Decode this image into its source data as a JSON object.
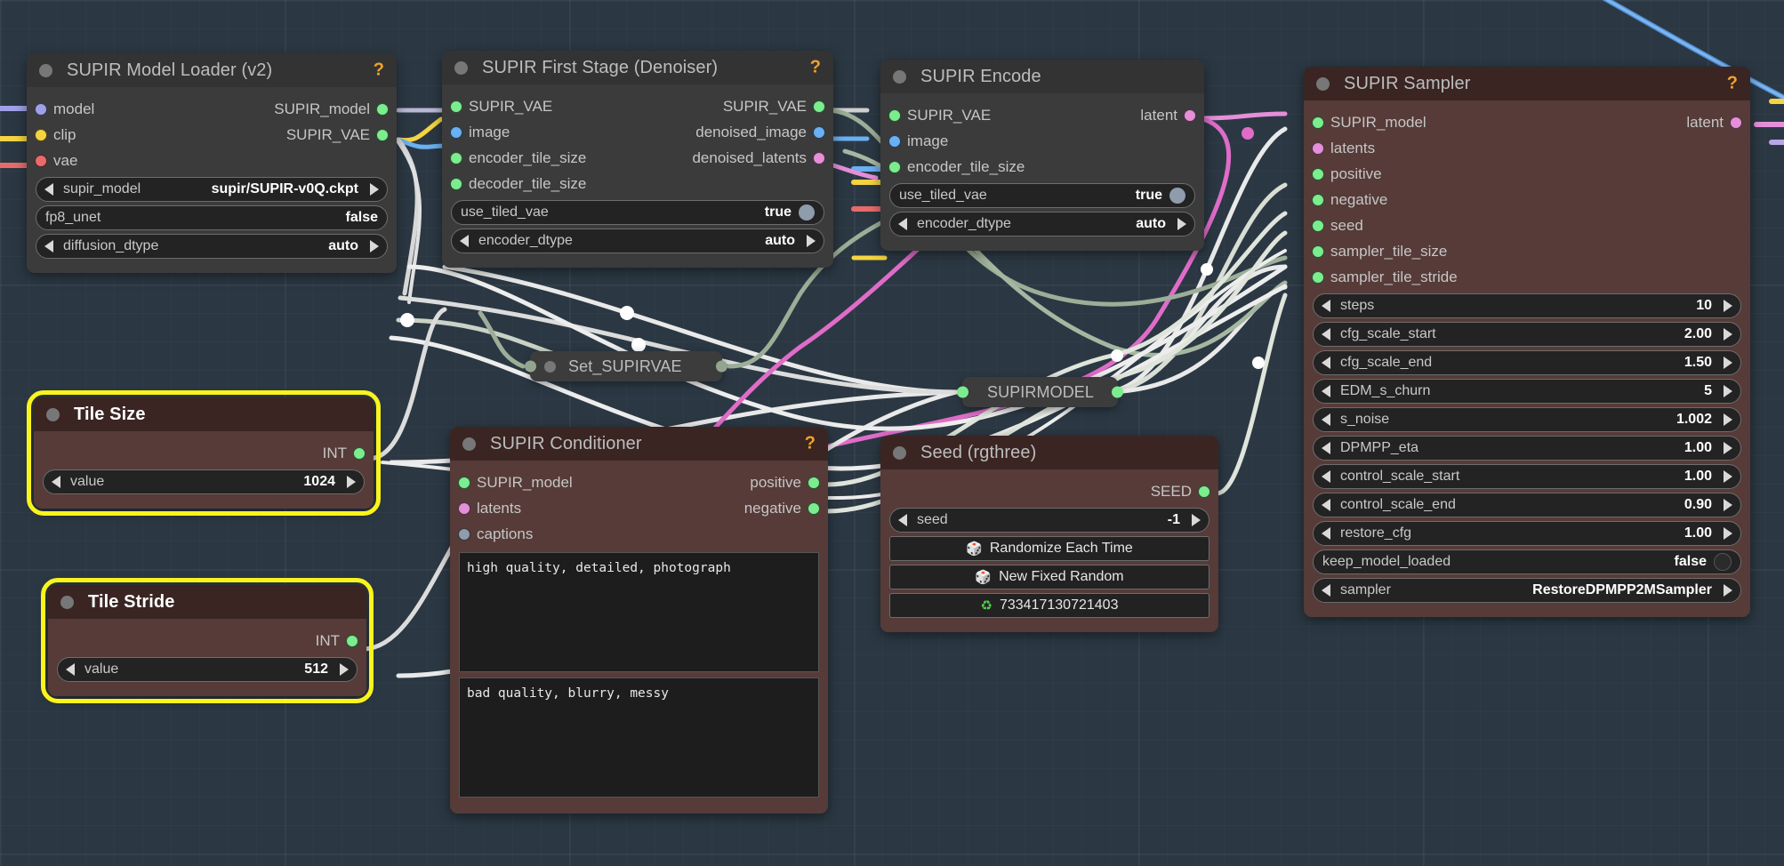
{
  "canvas": {
    "background_color": "#2b3843",
    "grid": true
  },
  "nodes": [
    {
      "id": "supir-model-loader",
      "title": "SUPIR Model Loader (v2)",
      "skin": "dark",
      "help": "?",
      "inputs": [
        {
          "label": "model",
          "color": "#a0a0e8"
        },
        {
          "label": "clip",
          "color": "#f5d442"
        },
        {
          "label": "vae",
          "color": "#e86b6b"
        }
      ],
      "outputs": [
        {
          "label": "SUPIR_model",
          "color": "#7bed8f"
        },
        {
          "label": "SUPIR_VAE",
          "color": "#7bed8f"
        }
      ],
      "widgets": [
        {
          "kind": "combo",
          "name": "supir_model",
          "value": "supir/SUPIR-v0Q.ckpt"
        },
        {
          "kind": "toggle",
          "name": "fp8_unet",
          "value": "false",
          "on": false
        },
        {
          "kind": "combo",
          "name": "diffusion_dtype",
          "value": "auto"
        }
      ]
    },
    {
      "id": "supir-first-stage",
      "title": "SUPIR First Stage (Denoiser)",
      "skin": "dark",
      "help": "?",
      "inputs": [
        {
          "label": "SUPIR_VAE",
          "color": "#7bed8f"
        },
        {
          "label": "image",
          "color": "#6ab0f3"
        },
        {
          "label": "encoder_tile_size",
          "color": "#7bed8f"
        },
        {
          "label": "decoder_tile_size",
          "color": "#7bed8f"
        }
      ],
      "outputs": [
        {
          "label": "SUPIR_VAE",
          "color": "#7bed8f"
        },
        {
          "label": "denoised_image",
          "color": "#6ab0f3"
        },
        {
          "label": "denoised_latents",
          "color": "#e58fd8"
        }
      ],
      "widgets": [
        {
          "kind": "toggle",
          "name": "use_tiled_vae",
          "value": "true",
          "on": true
        },
        {
          "kind": "combo",
          "name": "encoder_dtype",
          "value": "auto"
        }
      ]
    },
    {
      "id": "supir-encode",
      "title": "SUPIR Encode",
      "skin": "dark",
      "help": "",
      "inputs": [
        {
          "label": "SUPIR_VAE",
          "color": "#7bed8f"
        },
        {
          "label": "image",
          "color": "#6ab0f3"
        },
        {
          "label": "encoder_tile_size",
          "color": "#7bed8f"
        }
      ],
      "outputs": [
        {
          "label": "latent",
          "color": "#e58fd8"
        }
      ],
      "widgets": [
        {
          "kind": "toggle",
          "name": "use_tiled_vae",
          "value": "true",
          "on": true
        },
        {
          "kind": "combo",
          "name": "encoder_dtype",
          "value": "auto"
        }
      ]
    },
    {
      "id": "supir-sampler",
      "title": "SUPIR Sampler",
      "skin": "maroon",
      "help": "?",
      "inputs": [
        {
          "label": "SUPIR_model",
          "color": "#7bed8f"
        },
        {
          "label": "latents",
          "color": "#e58fd8"
        },
        {
          "label": "positive",
          "color": "#7bed8f"
        },
        {
          "label": "negative",
          "color": "#7bed8f"
        },
        {
          "label": "seed",
          "color": "#7bed8f"
        },
        {
          "label": "sampler_tile_size",
          "color": "#7bed8f"
        },
        {
          "label": "sampler_tile_stride",
          "color": "#7bed8f"
        }
      ],
      "outputs": [
        {
          "label": "latent",
          "color": "#e58fd8"
        }
      ],
      "widgets": [
        {
          "kind": "combo",
          "name": "steps",
          "value": "10"
        },
        {
          "kind": "combo",
          "name": "cfg_scale_start",
          "value": "2.00"
        },
        {
          "kind": "combo",
          "name": "cfg_scale_end",
          "value": "1.50"
        },
        {
          "kind": "combo",
          "name": "EDM_s_churn",
          "value": "5"
        },
        {
          "kind": "combo",
          "name": "s_noise",
          "value": "1.002"
        },
        {
          "kind": "combo",
          "name": "DPMPP_eta",
          "value": "1.00"
        },
        {
          "kind": "combo",
          "name": "control_scale_start",
          "value": "1.00"
        },
        {
          "kind": "combo",
          "name": "control_scale_end",
          "value": "0.90"
        },
        {
          "kind": "combo",
          "name": "restore_cfg",
          "value": "1.00"
        },
        {
          "kind": "toggle",
          "name": "keep_model_loaded",
          "value": "false",
          "on": false
        },
        {
          "kind": "combo",
          "name": "sampler",
          "value": "RestoreDPMPP2MSampler"
        }
      ]
    },
    {
      "id": "tile-size",
      "title": "Tile Size",
      "skin": "maroon",
      "selected": true,
      "help": "",
      "inputs": [],
      "outputs": [
        {
          "label": "INT",
          "color": "#7bed8f"
        }
      ],
      "widgets": [
        {
          "kind": "combo",
          "name": "value",
          "value": "1024"
        }
      ]
    },
    {
      "id": "tile-stride",
      "title": "Tile Stride",
      "skin": "maroon",
      "selected": true,
      "help": "",
      "inputs": [],
      "outputs": [
        {
          "label": "INT",
          "color": "#7bed8f"
        }
      ],
      "widgets": [
        {
          "kind": "combo",
          "name": "value",
          "value": "512"
        }
      ]
    },
    {
      "id": "supir-conditioner",
      "title": "SUPIR Conditioner",
      "skin": "maroon",
      "help": "?",
      "inputs": [
        {
          "label": "SUPIR_model",
          "color": "#7bed8f"
        },
        {
          "label": "latents",
          "color": "#e58fd8"
        },
        {
          "label": "captions",
          "color": "#8e9cab"
        }
      ],
      "outputs": [
        {
          "label": "positive",
          "color": "#7bed8f"
        },
        {
          "label": "negative",
          "color": "#7bed8f"
        }
      ],
      "widgets": [
        {
          "kind": "text",
          "name": "positive_prompt",
          "value": "high quality, detailed, photograph"
        },
        {
          "kind": "text",
          "name": "negative_prompt",
          "value": "bad quality, blurry, messy"
        }
      ]
    },
    {
      "id": "seed-rgthree",
      "title": "Seed (rgthree)",
      "skin": "maroon",
      "help": "",
      "inputs": [],
      "outputs": [
        {
          "label": "SEED",
          "color": "#7bed8f"
        }
      ],
      "widgets": [
        {
          "kind": "combo",
          "name": "seed",
          "value": "-1"
        },
        {
          "kind": "button",
          "name": "randomize_each_time",
          "icon": "dice-icon",
          "glyph": "🎲",
          "value": "Randomize Each Time"
        },
        {
          "kind": "button",
          "name": "new_fixed_random",
          "icon": "dice-icon",
          "glyph": "🎲",
          "value": "New Fixed Random"
        },
        {
          "kind": "button",
          "name": "last_seed",
          "icon": "recycle-icon",
          "glyph": "♻",
          "value": "733417130721403"
        }
      ]
    }
  ],
  "collapsed_nodes": [
    {
      "id": "set-supirvae",
      "title": "Set_SUPIRVAE",
      "left_port_color": "#93a58e",
      "right_port_color": "#93a58e"
    },
    {
      "id": "supirmodel",
      "title": "SUPIRMODEL",
      "left_port_color": "#7bed8f",
      "right_port_color": "#7bed8f"
    }
  ]
}
